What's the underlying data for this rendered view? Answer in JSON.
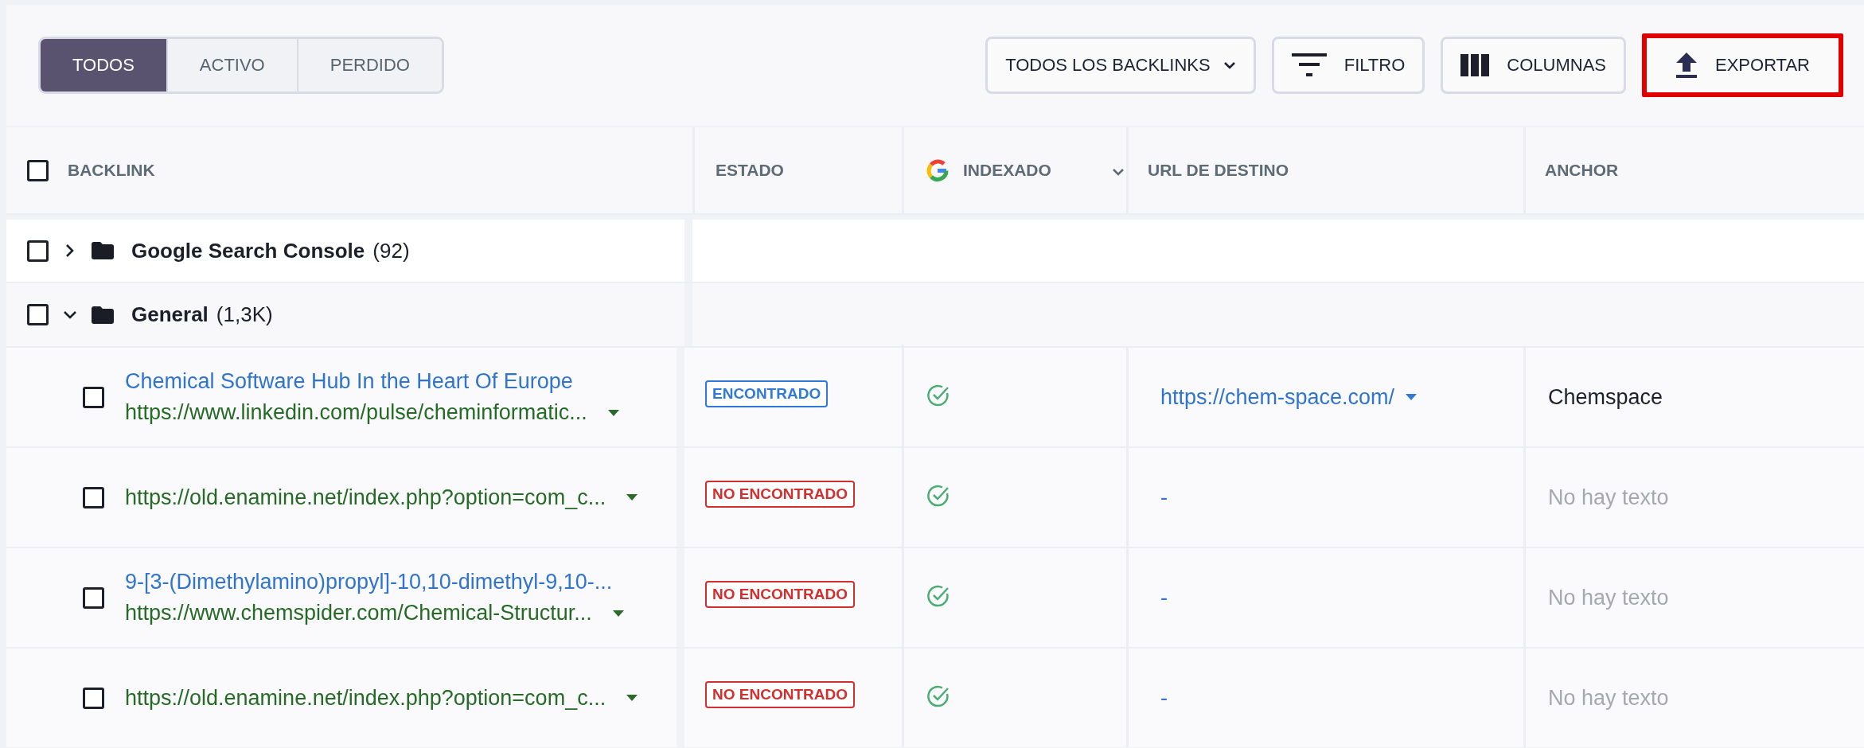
{
  "tabs": [
    {
      "label": "TODOS",
      "selected": true
    },
    {
      "label": "ACTIVO",
      "selected": false
    },
    {
      "label": "PERDIDO",
      "selected": false
    }
  ],
  "toolbar": {
    "dropdown": "TODOS LOS BACKLINKS",
    "buttons": [
      {
        "label": "FILTRO",
        "kind": "filter",
        "highlighted": false
      },
      {
        "label": "COLUMNAS",
        "kind": "columns",
        "highlighted": false
      },
      {
        "label": "EXPORTAR",
        "kind": "export",
        "highlighted": true
      }
    ]
  },
  "table": {
    "select_all_checked": false,
    "columns": [
      {
        "label": "BACKLINK",
        "kind": "select"
      },
      {
        "label": "ESTADO",
        "kind": "plain"
      },
      {
        "label": "INDEXADO",
        "kind": "google"
      },
      {
        "label": "URL DE DESTINO",
        "kind": "plain"
      },
      {
        "label": "ANCHOR",
        "kind": "plain"
      }
    ],
    "groups": [
      {
        "name": "Google Search Console",
        "count": "(92)",
        "expanded": false,
        "checked": false
      },
      {
        "name": "General",
        "count": "(1,3K)",
        "expanded": true,
        "checked": false
      }
    ],
    "rows": [
      {
        "checked": false,
        "title": "Chemical Software Hub In the Heart Of Europe",
        "url": "https://www.linkedin.com/pulse/cheminformatic...",
        "status": {
          "label": "ENCONTRADO",
          "color": "#2f7ad9"
        },
        "indexed": true,
        "target_url": "https://chem-space.com/",
        "target_menu": true,
        "anchor": "Chemspace",
        "anchor_empty": false
      },
      {
        "checked": false,
        "url": "https://old.enamine.net/index.php?option=com_c...",
        "status": {
          "label": "NO ENCONTRADO",
          "color": "#d32f2f"
        },
        "indexed": true,
        "target_url": "-",
        "target_menu": false,
        "anchor": "No hay texto",
        "anchor_empty": true
      },
      {
        "checked": false,
        "title": "9-[3-(Dimethylamino)propyl]-10,10-dimethyl-9,10-...",
        "url": "https://www.chemspider.com/Chemical-Structur...",
        "status": {
          "label": "NO ENCONTRADO",
          "color": "#d32f2f"
        },
        "indexed": true,
        "target_url": "-",
        "target_menu": false,
        "anchor": "No hay texto",
        "anchor_empty": true
      },
      {
        "checked": false,
        "url": "https://old.enamine.net/index.php?option=com_c...",
        "status": {
          "label": "NO ENCONTRADO",
          "color": "#d32f2f"
        },
        "indexed": true,
        "target_url": "-",
        "target_menu": false,
        "anchor": "No hay texto",
        "anchor_empty": true
      }
    ]
  }
}
